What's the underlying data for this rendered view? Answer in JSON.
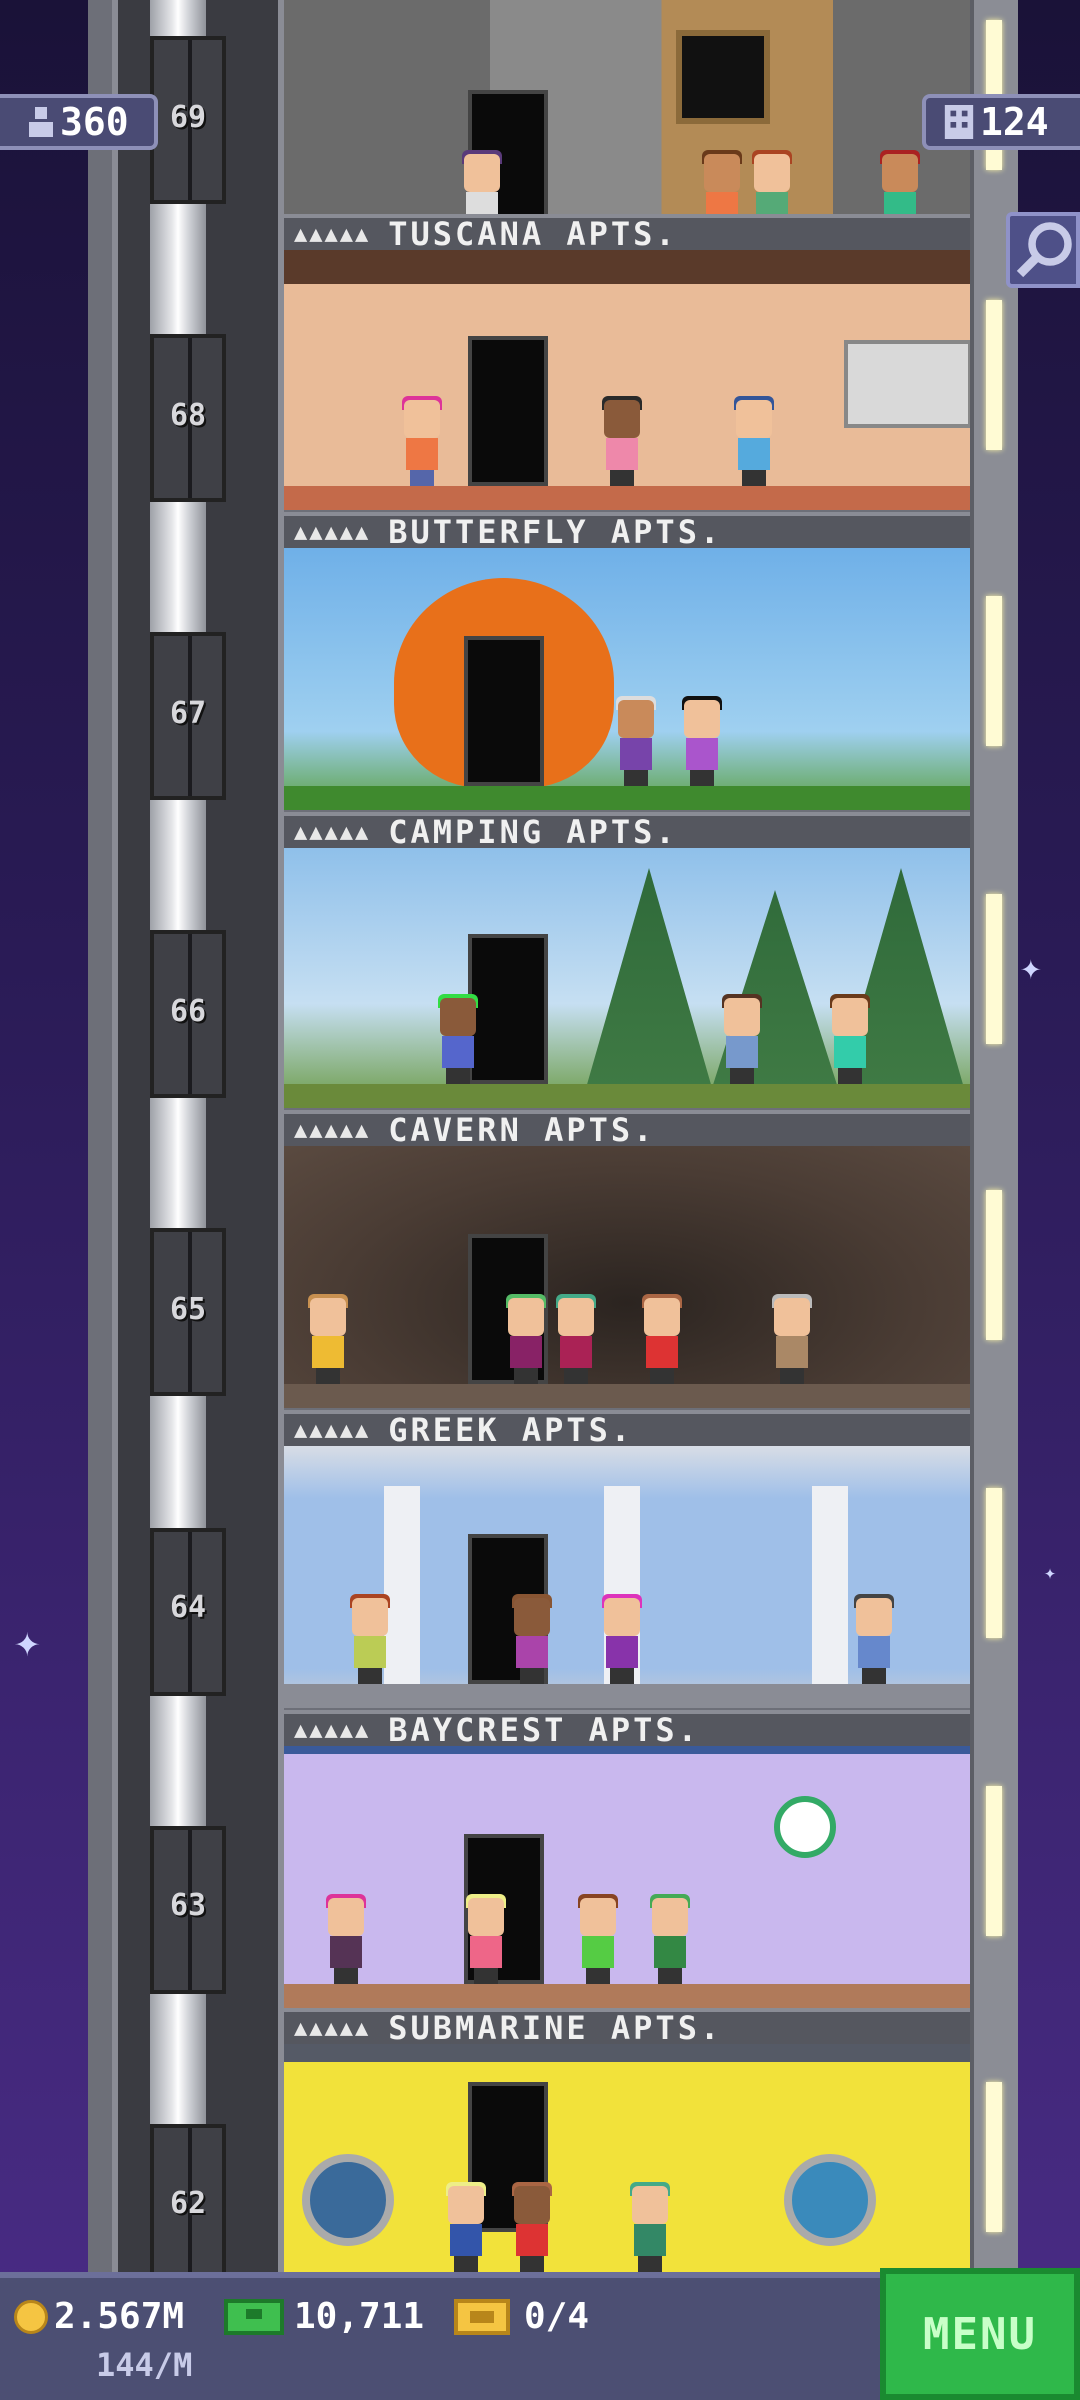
{
  "top_bar": {
    "population_label": "360",
    "population_icon": "person-icon",
    "floors_label": "124",
    "floors_icon": "building-icon",
    "search_icon": "magnifier-icon"
  },
  "floors": [
    {
      "number": "69",
      "name": "TUSCANA APTS.",
      "theme": "minecraft"
    },
    {
      "number": "68",
      "name": "BUTTERFLY APTS.",
      "theme": "tuscana"
    },
    {
      "number": "67",
      "name": "CAMPING APTS.",
      "theme": "butterfly"
    },
    {
      "number": "66",
      "name": "CAVERN APTS.",
      "theme": "camping"
    },
    {
      "number": "65",
      "name": "GREEK APTS.",
      "theme": "cavern"
    },
    {
      "number": "64",
      "name": "BAYCREST APTS.",
      "theme": "greek"
    },
    {
      "number": "63",
      "name": "SUBMARINE APTS.",
      "theme": "baycrest"
    },
    {
      "number": "62",
      "name": "",
      "theme": "submarine"
    }
  ],
  "sign_dots": "▲▲▲▲▲",
  "bottom_bar": {
    "coins": "2.567M",
    "coins_per_min": "144/M",
    "bux": "10,711",
    "tickets": "0/4",
    "menu_label": "MENU"
  },
  "colors": {
    "menu_green": "#2fb84a",
    "coin_gold": "#f5c542",
    "bux_green": "#3fbf4f"
  }
}
